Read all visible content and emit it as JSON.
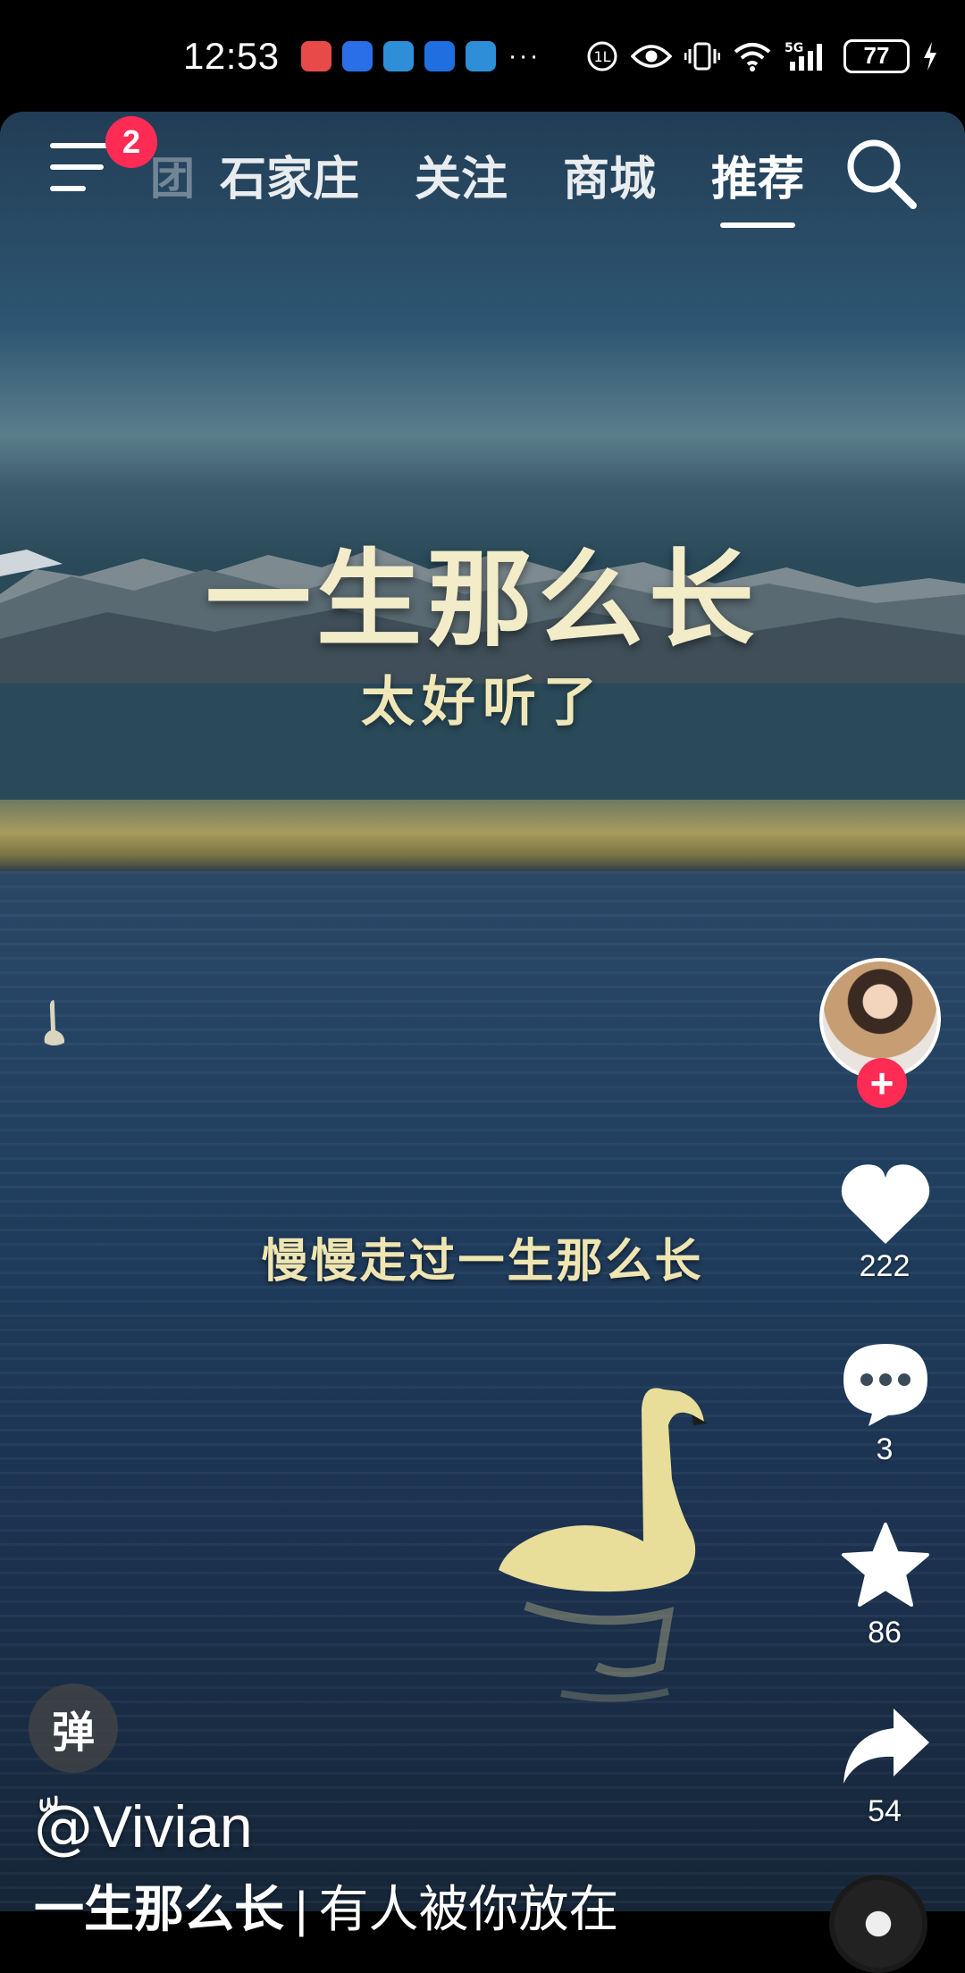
{
  "status_bar": {
    "time": "12:53",
    "app_icon_colors": [
      "#e84a4a",
      "#2a6fe8",
      "#2e8fd8",
      "#1f6fe0",
      "#2e8fd8"
    ],
    "more": "···",
    "network": "5G",
    "battery": "77"
  },
  "nav": {
    "badge": "2",
    "cut_tab": "团",
    "tabs": [
      {
        "label": "石家庄",
        "active": false
      },
      {
        "label": "关注",
        "active": false
      },
      {
        "label": "商城",
        "active": false
      },
      {
        "label": "推荐",
        "active": true
      }
    ],
    "search_icon": "search-icon",
    "menu_icon": "menu-icon"
  },
  "video": {
    "title": "一生那么长",
    "subtitle": "太好听了",
    "lyric": "慢慢走过一生那么长"
  },
  "rail": {
    "follow": "+",
    "likes": "222",
    "comments": "3",
    "favorites": "86",
    "shares": "54"
  },
  "bottom": {
    "danmu": "弹",
    "author": "@ّVivian",
    "caption_title": "一生那么长",
    "caption_sep": "|",
    "caption_rest": "有人被你放在"
  },
  "colors": {
    "accent": "#fe2c55",
    "lyric_text": "#efe5b2"
  }
}
